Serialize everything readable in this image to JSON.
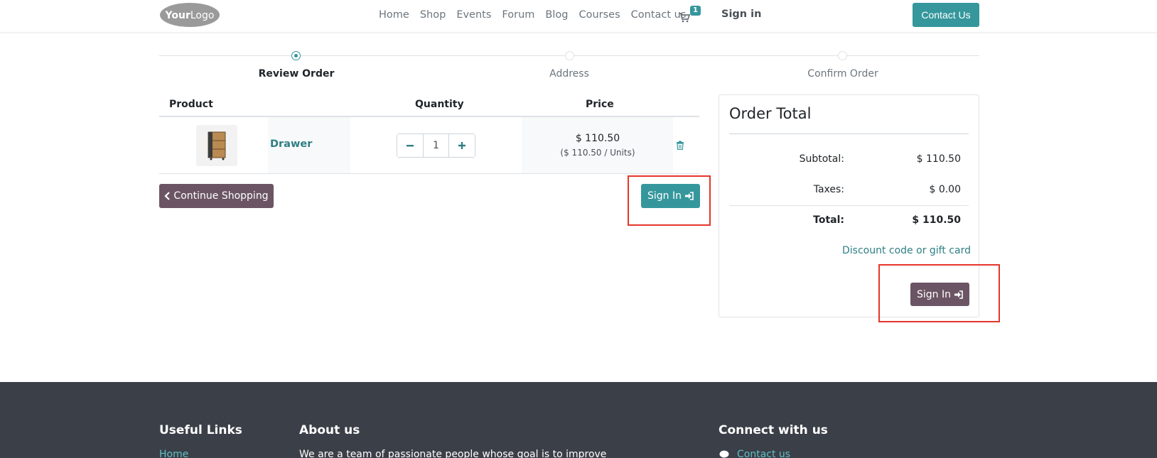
{
  "header": {
    "logo_text": "YourLogo",
    "nav": [
      "Home",
      "Shop",
      "Events",
      "Forum",
      "Blog",
      "Courses",
      "Contact us"
    ],
    "cart_count": "1",
    "sign_in": "Sign in",
    "contact_button": "Contact Us"
  },
  "progress": {
    "steps": [
      "Review Order",
      "Address",
      "Confirm Order"
    ],
    "active_index": 0
  },
  "cart_table": {
    "headers": {
      "product": "Product",
      "quantity": "Quantity",
      "price": "Price"
    },
    "rows": [
      {
        "name": "Drawer",
        "quantity": "1",
        "price": "$ 110.50",
        "unit_price": "($ 110.50 / Units)"
      }
    ],
    "continue_button": "Continue Shopping",
    "sign_in_button": "Sign In"
  },
  "order_total": {
    "title": "Order Total",
    "subtotal_label": "Subtotal:",
    "subtotal": "$ 110.50",
    "taxes_label": "Taxes:",
    "taxes": "$ 0.00",
    "total_label": "Total:",
    "total": "$ 110.50",
    "discount_link": "Discount code or gift card",
    "sign_in_button": "Sign In"
  },
  "footer": {
    "useful_links_title": "Useful Links",
    "useful_links": [
      "Home"
    ],
    "about_title": "About us",
    "about_text": "We are a team of passionate people whose goal is to improve",
    "connect_title": "Connect with us",
    "connect_links": [
      "Contact us"
    ]
  },
  "colors": {
    "accent": "#35979c",
    "secondary": "#6b5564",
    "footer": "#3b3f47",
    "highlight": "#e5352c"
  }
}
